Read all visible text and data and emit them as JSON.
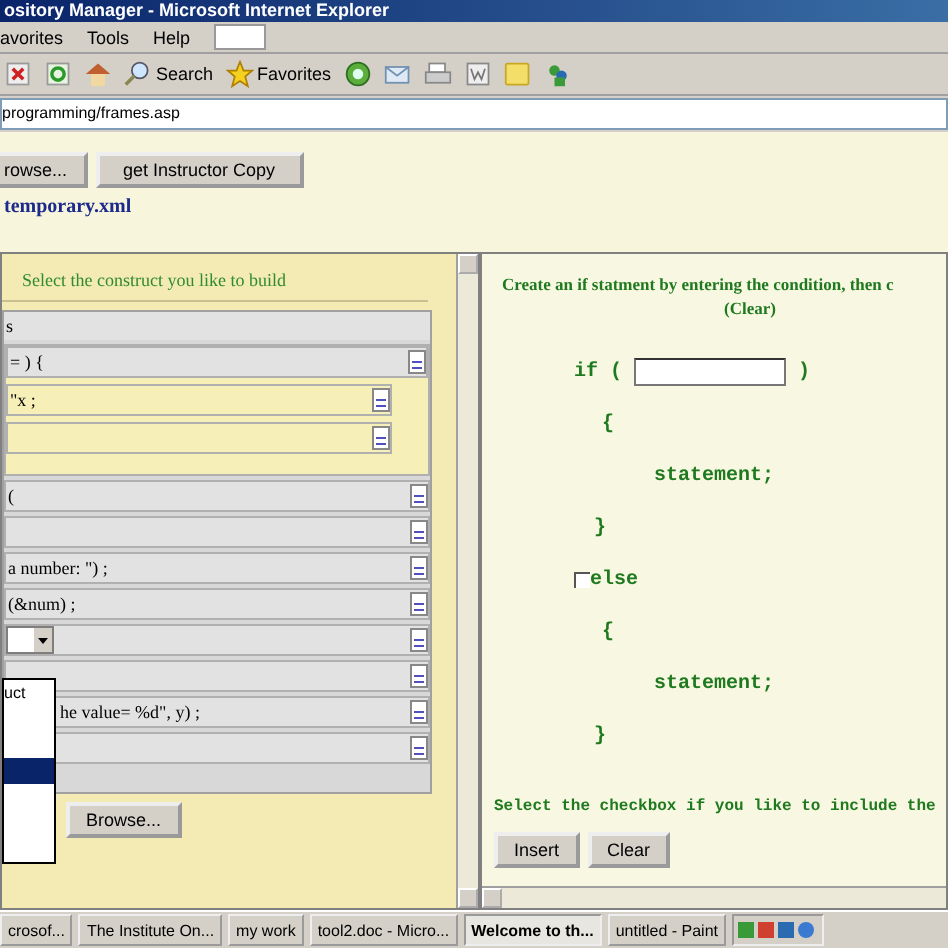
{
  "window": {
    "title": "ository Manager - Microsoft Internet Explorer"
  },
  "menu": [
    "avorites",
    "Tools",
    "Help"
  ],
  "toolbar": {
    "search_label": "Search",
    "favorites_label": "Favorites"
  },
  "address": "programming/frames.asp",
  "top_buttons": [
    "rowse...",
    "get Instructor Copy"
  ],
  "file_name": "temporary.xml",
  "left_frame": {
    "heading": "Select the construct you like to build",
    "rows": [
      {
        "kind": "header",
        "text": "s"
      },
      {
        "kind": "group",
        "text": "= ) {",
        "children": [
          {
            "kind": "line",
            "text": "\"x ;"
          },
          {
            "kind": "line"
          }
        ]
      },
      {
        "kind": "line",
        "text": "("
      },
      {
        "kind": "line"
      },
      {
        "kind": "line",
        "text": "a number: \") ;"
      },
      {
        "kind": "line",
        "text": "(&num) ;"
      },
      {
        "kind": "select"
      },
      {
        "kind": "line"
      },
      {
        "kind": "line",
        "text": "he value= %d\", y) ;"
      },
      {
        "kind": "line"
      }
    ],
    "dropdown": [
      {
        "text": "uct",
        "selected": false
      },
      {
        "selected": false
      },
      {
        "selected": false
      },
      {
        "selected": true
      },
      {
        "selected": false
      },
      {
        "selected": false
      },
      {
        "selected": false
      }
    ],
    "browse": "Browse..."
  },
  "right_frame": {
    "instruction": "Create an if statment by entering the condition, then c",
    "clear_link": "(Clear)",
    "if_keyword": "if (",
    "if_close": ")",
    "lines": [
      "{",
      "statement;",
      "}"
    ],
    "else": {
      "label": "else",
      "checked": false
    },
    "else_lines": [
      "{",
      "statement;",
      "}"
    ],
    "note": "Select the checkbox if you like to include the",
    "buttons": [
      "Insert",
      "Clear"
    ]
  },
  "taskbar": [
    {
      "text": "crosof...",
      "selected": false
    },
    {
      "text": "The Institute On...",
      "selected": false
    },
    {
      "text": "my work",
      "selected": false
    },
    {
      "text": "tool2.doc - Micro...",
      "selected": false
    },
    {
      "text": "Welcome to th...",
      "selected": true
    },
    {
      "text": "untitled - Paint",
      "selected": false
    }
  ]
}
